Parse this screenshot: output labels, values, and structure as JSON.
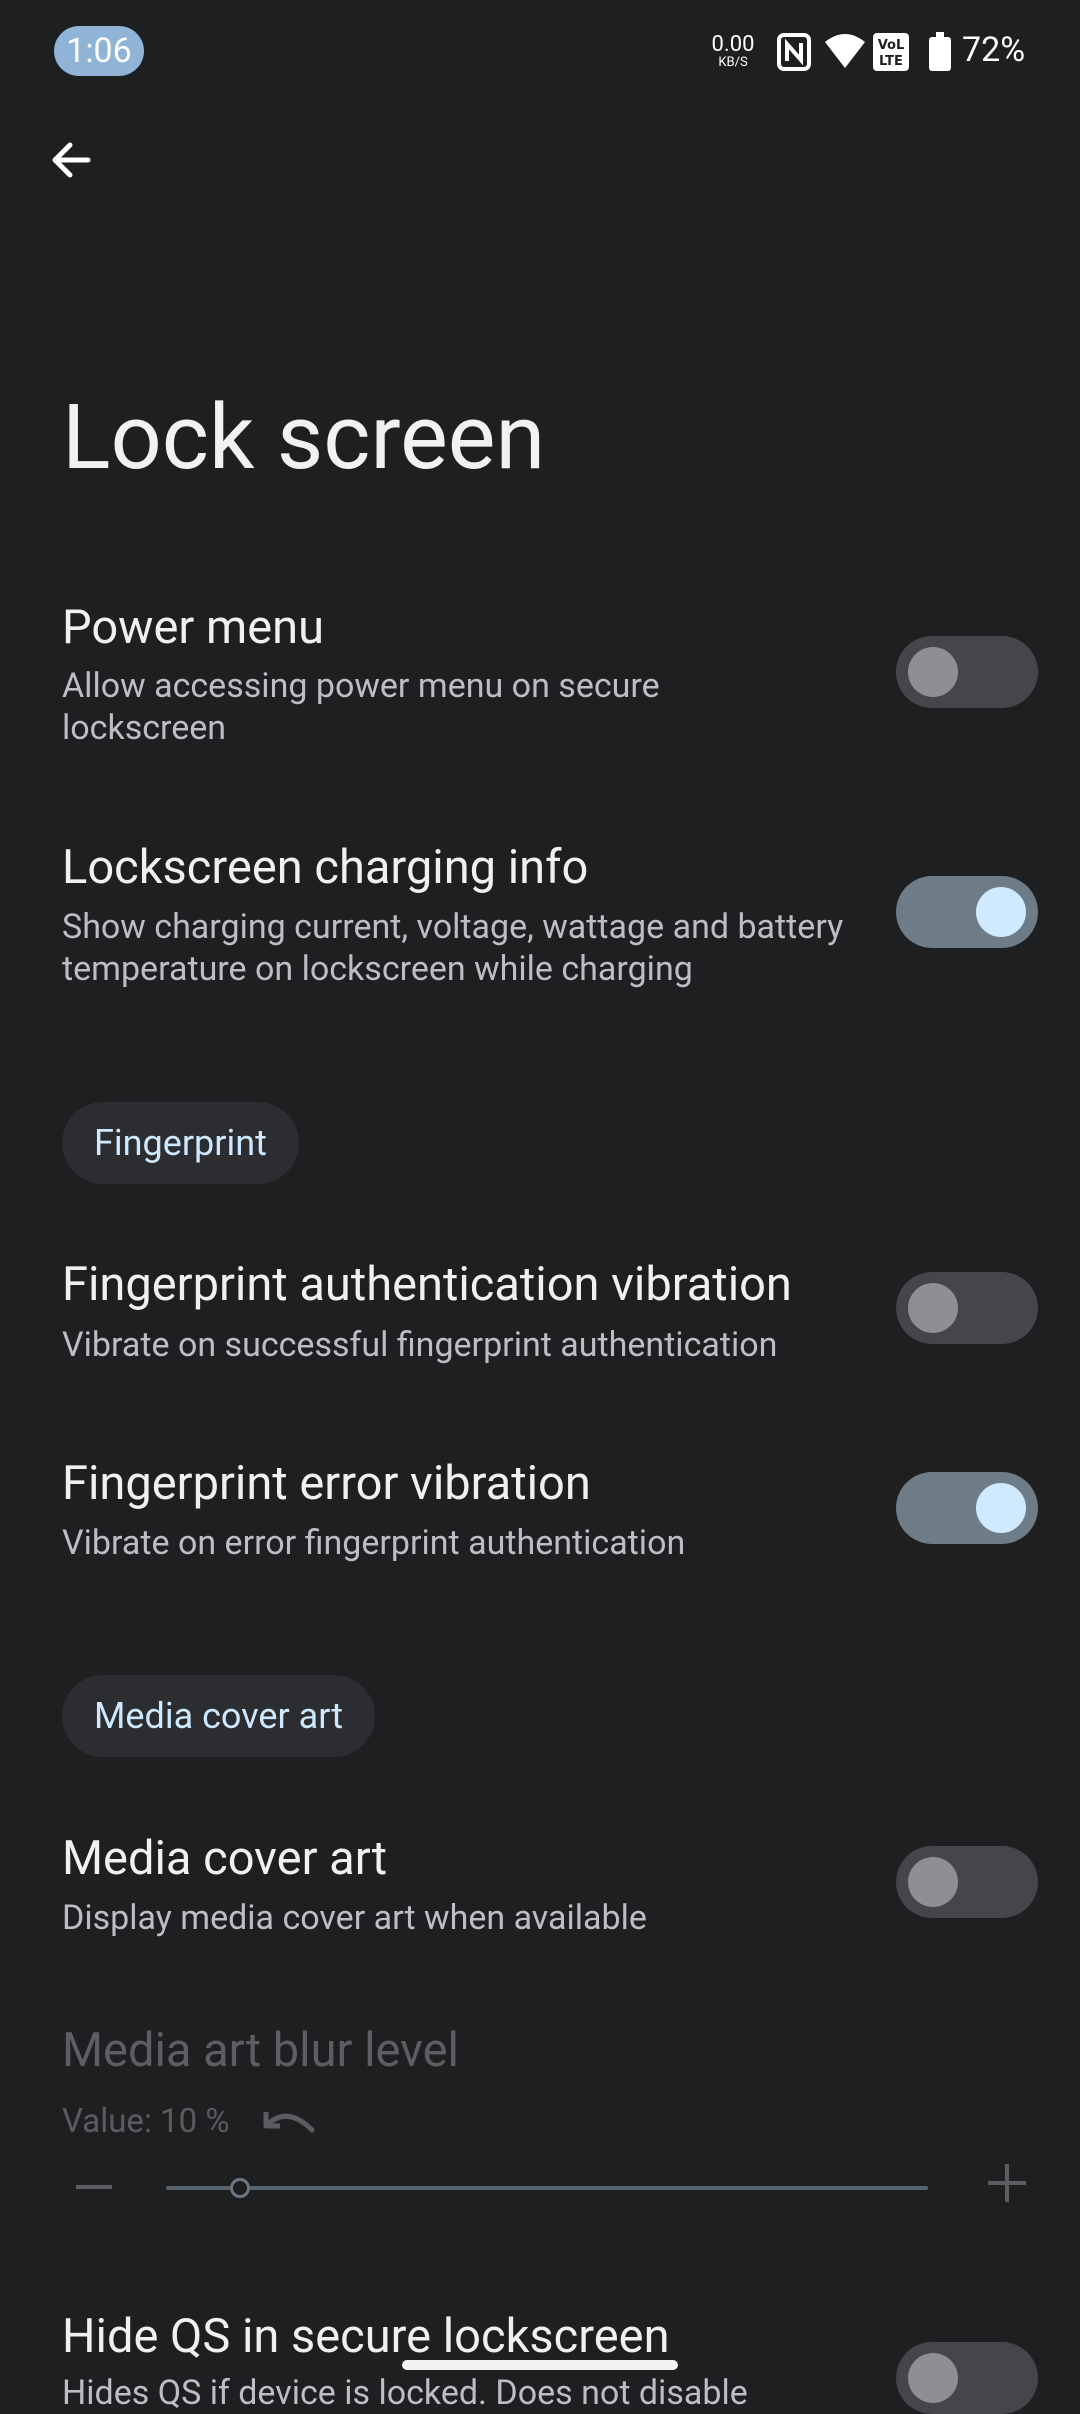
{
  "status_bar": {
    "time": "1:06",
    "net_speed_value": "0.00",
    "net_speed_unit": "KB/S",
    "battery_percent": "72%",
    "icons": [
      "nfc-icon",
      "wifi-icon",
      "volte-icon",
      "battery-icon"
    ]
  },
  "header": {
    "back_icon": "arrow-left-icon",
    "title": "Lock screen"
  },
  "settings": {
    "power_menu": {
      "title": "Power menu",
      "subtitle": "Allow accessing power menu on secure lockscreen",
      "enabled": false
    },
    "charging_info": {
      "title": "Lockscreen charging info",
      "subtitle": "Show charging current, voltage, wattage and battery temperature on lockscreen while charging",
      "enabled": true
    },
    "fingerprint_section": "Fingerprint",
    "fp_auth_vibration": {
      "title": "Fingerprint authentication vibration",
      "subtitle": "Vibrate on successful fingerprint authentication",
      "enabled": false
    },
    "fp_error_vibration": {
      "title": "Fingerprint error vibration",
      "subtitle": "Vibrate on error fingerprint authentication",
      "enabled": true
    },
    "media_section": "Media cover art",
    "media_cover_art": {
      "title": "Media cover art",
      "subtitle": "Display media cover art when available",
      "enabled": false
    },
    "media_blur": {
      "title": "Media art blur level",
      "value_label": "Value: 10 %",
      "value_percent": 10,
      "enabled": false
    },
    "hide_qs": {
      "title": "Hide QS in secure lockscreen",
      "subtitle": "Hides QS if device is locked. Does not disable",
      "enabled": false
    }
  },
  "colors": {
    "background": "#1e1f21",
    "accent": "#cfe9ff",
    "toggle_on_track": "#6e7c87",
    "toggle_off_track": "#454649"
  }
}
